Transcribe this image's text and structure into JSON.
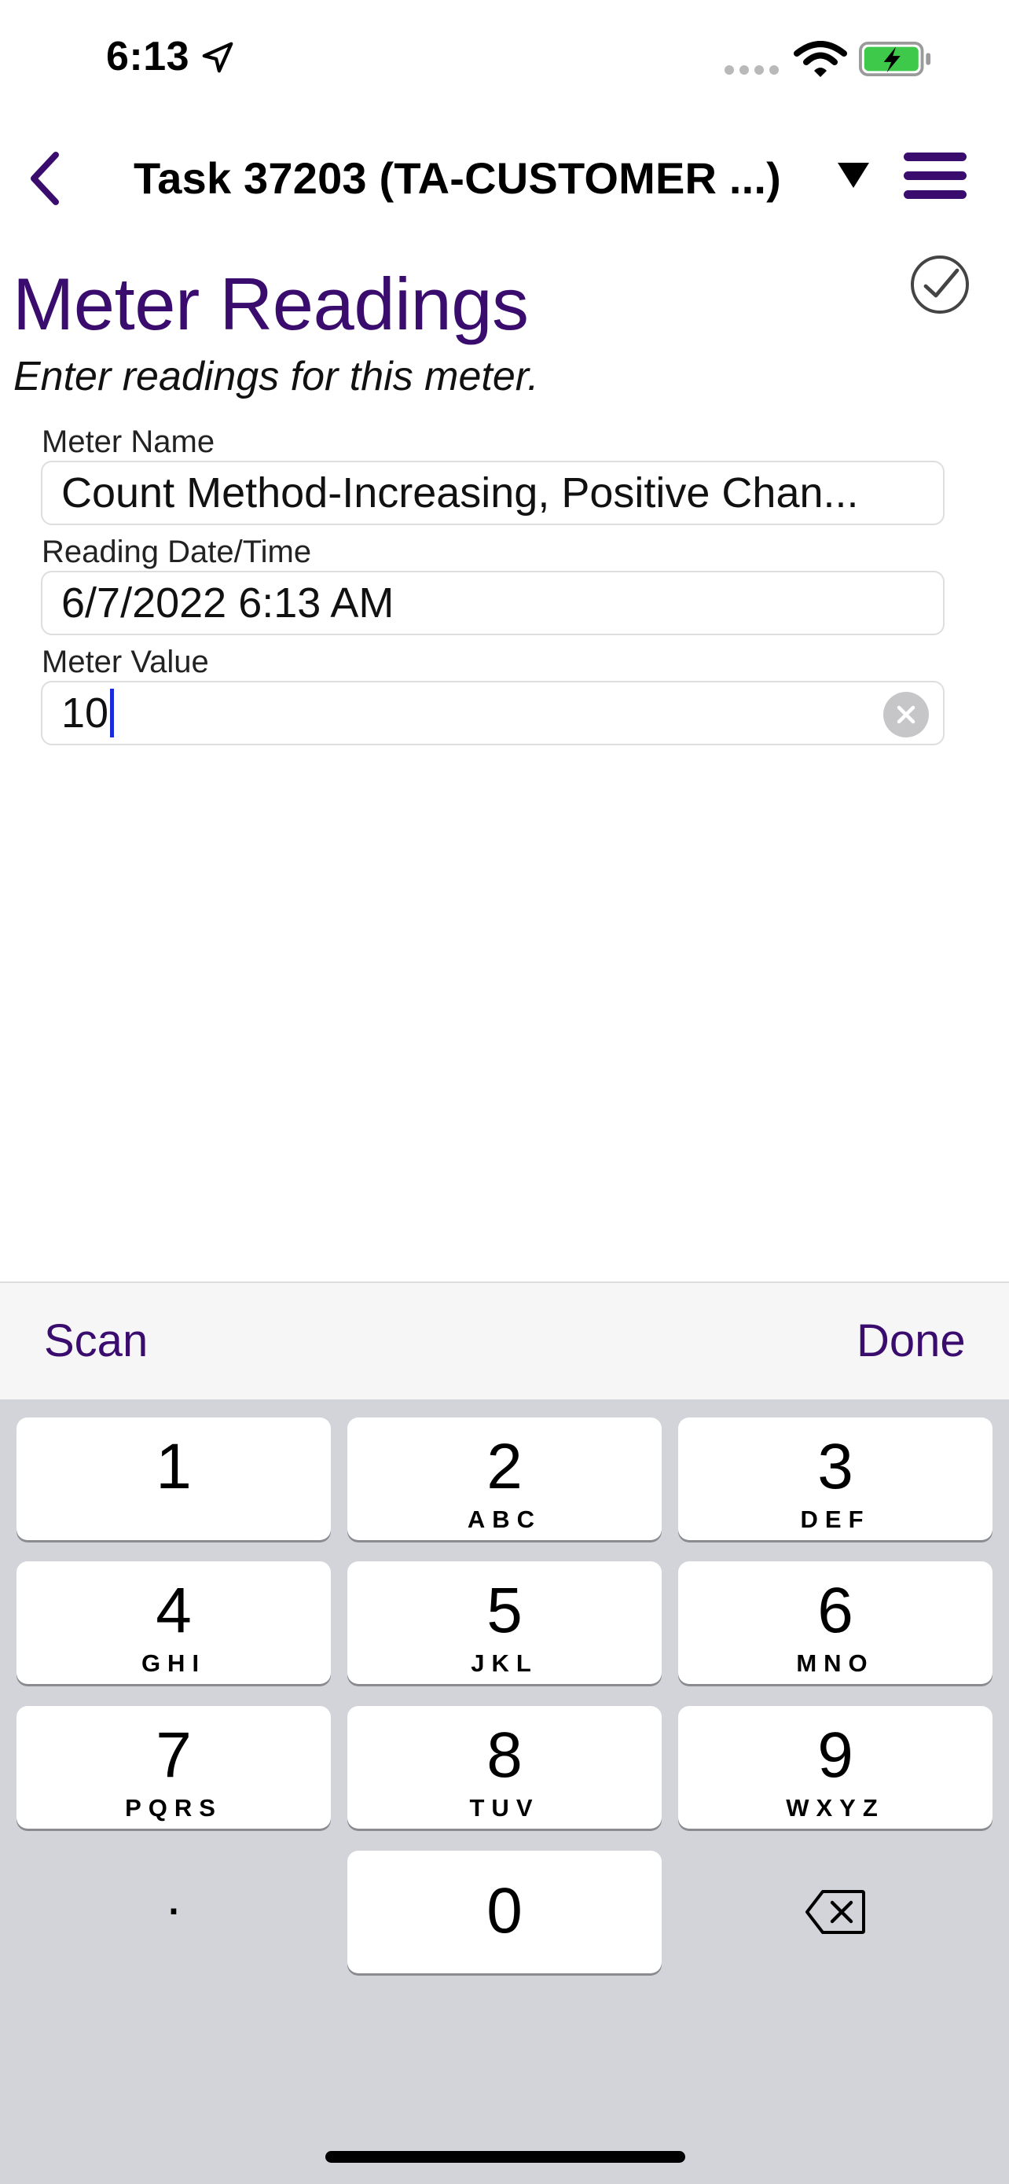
{
  "status_bar": {
    "time": "6:13"
  },
  "nav": {
    "title": "Task 37203 (TA-CUSTOMER ...)"
  },
  "header": {
    "title": "Meter Readings",
    "subtitle": "Enter readings for this meter."
  },
  "fields": {
    "meter_name": {
      "label": "Meter Name",
      "value": "Count Method-Increasing, Positive Chan..."
    },
    "reading_datetime": {
      "label": "Reading Date/Time",
      "value": "6/7/2022 6:13 AM"
    },
    "meter_value": {
      "label": "Meter Value",
      "value": "10"
    }
  },
  "accessory": {
    "scan_label": "Scan",
    "done_label": "Done"
  },
  "keyboard": {
    "keys": [
      {
        "num": "1",
        "letters": ""
      },
      {
        "num": "2",
        "letters": "ABC"
      },
      {
        "num": "3",
        "letters": "DEF"
      },
      {
        "num": "4",
        "letters": "GHI"
      },
      {
        "num": "5",
        "letters": "JKL"
      },
      {
        "num": "6",
        "letters": "MNO"
      },
      {
        "num": "7",
        "letters": "PQRS"
      },
      {
        "num": "8",
        "letters": "TUV"
      },
      {
        "num": "9",
        "letters": "WXYZ"
      },
      {
        "num": "0",
        "letters": ""
      }
    ],
    "decimal": "."
  },
  "colors": {
    "accent": "#3a0c6e",
    "caret": "#1a2bdc",
    "battery": "#3ec94a"
  }
}
